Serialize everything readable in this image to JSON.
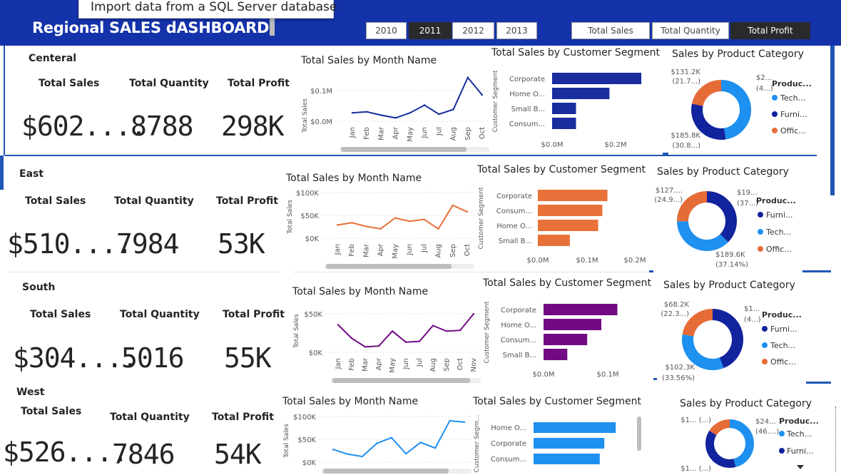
{
  "header": {
    "title": "Regional SALES dASHBOARD",
    "tooltip": "Import data from a SQL Server database.",
    "years": [
      "2010",
      "2011",
      "2012",
      "2013"
    ],
    "selected_year": "2011",
    "measures": [
      "Total Sales",
      "Total Quantity",
      "Total Profit"
    ],
    "selected_measure": "Total Profit"
  },
  "colors": {
    "central": "#1a2d9e",
    "east": "#e8713a",
    "south": "#720b83",
    "west": "#1e90f0",
    "header": "#1432aa",
    "technology": "#1e90f0",
    "furniture": "#12239e",
    "office": "#e66c37"
  },
  "kpi_labels": {
    "sales": "Total Sales",
    "quantity": "Total Quantity",
    "profit": "Total Profit"
  },
  "chart_titles": {
    "month": "Total Sales by Month Name",
    "segment": "Total Sales by Customer Segment",
    "category": "Sales by Product Category"
  },
  "axis_labels": {
    "total_sales": "Total Sales",
    "customer_segment": "Customer Segment",
    "legend_title": "Produc..."
  },
  "regions": [
    {
      "name": "Centeral",
      "sales": "$602....",
      "quantity": "8788",
      "profit": "298K",
      "month_ticks": [
        "$0.0M",
        "$0.1M"
      ],
      "seg_ticks": [
        "$0.0M",
        "$0.2M"
      ],
      "segments": [
        "Corporate",
        "Home O...",
        "Small B...",
        "Consum..."
      ],
      "donut_labels": [
        "$131.2K",
        "(21.7...)",
        "$2...",
        "(4...)",
        "$185.8K",
        "(30.8...)"
      ],
      "legend": [
        "Tech...",
        "Furni...",
        "Offic..."
      ]
    },
    {
      "name": "East",
      "sales": "$510....",
      "quantity": "7984",
      "profit": "53K",
      "month_ticks": [
        "$0K",
        "$50K",
        "$100K"
      ],
      "seg_ticks": [
        "$0.0M",
        "$0.1M",
        "$0.2M"
      ],
      "segments": [
        "Corporate",
        "Consum...",
        "Home O...",
        "Small B..."
      ],
      "donut_labels": [
        "$127....",
        "(24.9...)",
        "$19...",
        "(37...)",
        "$189.6K",
        "(37.14%)"
      ],
      "legend": [
        "Furni...",
        "Tech...",
        "Offic..."
      ]
    },
    {
      "name": "South",
      "sales": "$304....",
      "quantity": "5016",
      "profit": "55K",
      "month_ticks": [
        "$0K",
        "$50K"
      ],
      "seg_ticks": [
        "$0.0M",
        "$0.1M"
      ],
      "segments": [
        "Corporate",
        "Home O...",
        "Consum...",
        "Small B..."
      ],
      "donut_labels": [
        "$68.2K",
        "(22.3...)",
        "$1...",
        "(4...)",
        "$102.3K",
        "(33.56%)"
      ],
      "legend": [
        "Furni...",
        "Tech...",
        "Offic..."
      ]
    },
    {
      "name": "West",
      "sales": "$526....",
      "quantity": "7846",
      "profit": "54K",
      "month_ticks": [
        "$0K",
        "$50K",
        "$100K"
      ],
      "segments": [
        "Home O...",
        "Corporate",
        "Consum..."
      ],
      "donut_labels": [
        "$1... (...)",
        "$24...",
        "(46....)",
        "$1... (...)"
      ],
      "legend": [
        "Tech...",
        "Furni..."
      ],
      "seg_axis_label": "Customer Segm..."
    }
  ],
  "months_11": [
    "Jan",
    "Feb",
    "Mar",
    "Apr",
    "May",
    "Jun",
    "Jul",
    "Aug",
    "Sep",
    "Oct",
    "Nov"
  ],
  "chart_data": [
    {
      "type": "line",
      "title": "Total Sales by Month Name",
      "region": "Centeral",
      "ylabel": "Total Sales",
      "x": [
        "Jan",
        "Feb",
        "Mar",
        "Apr",
        "May",
        "Jun",
        "Jul",
        "Aug",
        "Sep",
        "Oct"
      ],
      "values": [
        25000,
        28000,
        18000,
        10000,
        25000,
        48000,
        21000,
        35000,
        130000,
        78000
      ],
      "ylim": [
        0,
        140000
      ]
    },
    {
      "type": "bar",
      "title": "Total Sales by Customer Segment",
      "region": "Centeral",
      "ylabel": "Customer Segment",
      "categories": [
        "Corporate",
        "Home O...",
        "Small B...",
        "Consum..."
      ],
      "values": [
        280000,
        180000,
        75000,
        75000
      ],
      "xlim": [
        0,
        300000
      ]
    },
    {
      "type": "pie",
      "title": "Sales by Product Category",
      "region": "Centeral",
      "categories": [
        "Technology",
        "Furniture",
        "Office"
      ],
      "values": [
        47.5,
        30.8,
        21.7
      ]
    },
    {
      "type": "line",
      "title": "Total Sales by Month Name",
      "region": "East",
      "ylabel": "Total Sales",
      "x": [
        "Jan",
        "Feb",
        "Mar",
        "Apr",
        "May",
        "Jun",
        "Jul",
        "Aug",
        "Sep",
        "Oct"
      ],
      "values": [
        28000,
        33000,
        25000,
        20000,
        43000,
        36000,
        40000,
        20000,
        70000,
        56000
      ],
      "ylim": [
        0,
        100000
      ]
    },
    {
      "type": "bar",
      "title": "Total Sales by Customer Segment",
      "region": "East",
      "ylabel": "Customer Segment",
      "categories": [
        "Corporate",
        "Consum...",
        "Home O...",
        "Small B..."
      ],
      "values": [
        165000,
        153000,
        143000,
        76000
      ],
      "xlim": [
        0,
        230000
      ]
    },
    {
      "type": "pie",
      "title": "Sales by Product Category",
      "region": "East",
      "categories": [
        "Furniture",
        "Technology",
        "Office"
      ],
      "values": [
        37.1,
        37.14,
        24.9
      ]
    },
    {
      "type": "line",
      "title": "Total Sales by Month Name",
      "region": "South",
      "ylabel": "Total Sales",
      "x": [
        "Jan",
        "Feb",
        "Mar",
        "Apr",
        "May",
        "Jun",
        "Jul",
        "Aug",
        "Sep",
        "Oct",
        "Nov"
      ],
      "values": [
        35000,
        18000,
        7000,
        8000,
        27000,
        13000,
        14000,
        34000,
        27000,
        28000,
        49000
      ],
      "ylim": [
        0,
        60000
      ]
    },
    {
      "type": "bar",
      "title": "Total Sales by Customer Segment",
      "region": "South",
      "ylabel": "Customer Segment",
      "categories": [
        "Corporate",
        "Home O...",
        "Consum...",
        "Small B..."
      ],
      "values": [
        115000,
        90000,
        68000,
        37000
      ],
      "xlim": [
        0,
        150000
      ]
    },
    {
      "type": "pie",
      "title": "Sales by Product Category",
      "region": "South",
      "categories": [
        "Furniture",
        "Technology",
        "Office"
      ],
      "values": [
        44.1,
        33.56,
        22.3
      ]
    },
    {
      "type": "line",
      "title": "Total Sales by Month Name",
      "region": "West",
      "ylabel": "Total Sales",
      "x": [
        "Jan",
        "Feb",
        "Mar",
        "Apr",
        "May",
        "Jun",
        "Jul",
        "Aug",
        "Sep",
        "Oct"
      ],
      "values": [
        27000,
        17000,
        12000,
        40000,
        52000,
        18000,
        42000,
        30000,
        88000,
        85000
      ],
      "ylim": [
        0,
        100000
      ]
    },
    {
      "type": "bar",
      "title": "Total Sales by Customer Segment",
      "region": "West",
      "ylabel": "Customer Segment",
      "categories": [
        "Home O...",
        "Corporate",
        "Consum..."
      ],
      "values": [
        180000,
        155000,
        145000
      ],
      "xlim": [
        0,
        200000
      ]
    },
    {
      "type": "pie",
      "title": "Sales by Product Category",
      "region": "West",
      "categories": [
        "Technology",
        "Furniture",
        "Office"
      ],
      "values": [
        46,
        38,
        16
      ]
    }
  ]
}
